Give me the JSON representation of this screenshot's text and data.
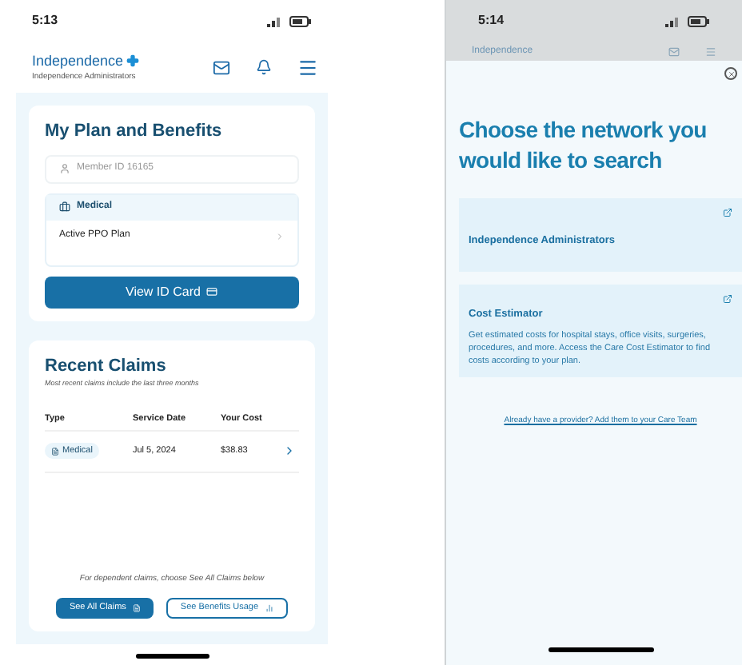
{
  "left_screen": {
    "status_time": "5:13",
    "brand": {
      "name": "Independence",
      "subtitle": "Independence Administrators"
    },
    "plan_card": {
      "title": "My Plan and Benefits",
      "member_id": "Member ID 16165",
      "coverage": {
        "label": "Medical",
        "plan": "Active PPO Plan"
      },
      "button": "View ID Card"
    },
    "claims_card": {
      "title": "Recent Claims",
      "subtitle": "Most recent claims include the last three months",
      "columns": [
        "Type",
        "Service Date",
        "Your Cost"
      ],
      "rows": [
        {
          "type": "Medical",
          "date": "Jul 5, 2024",
          "cost": "$38.83"
        }
      ],
      "note": "For dependent claims, choose See All Claims below",
      "buttons": [
        {
          "label": "See All Claims",
          "kind": "primary"
        },
        {
          "label": "See Benefits Usage",
          "kind": "secondary"
        }
      ]
    }
  },
  "right_screen": {
    "status_time": "5:14",
    "brand": {
      "name": "Independence"
    },
    "sheet": {
      "title": "Choose the network you would like to search",
      "options": [
        {
          "title": "Independence Administrators"
        },
        {
          "title": "Cost Estimator",
          "description": "Get estimated costs for hospital stays, office visits, surgeries, procedures, and more. Access the Care Cost Estimator to find costs according to your plan."
        }
      ],
      "link": "Already have a provider? Add them to your Care Team"
    }
  }
}
